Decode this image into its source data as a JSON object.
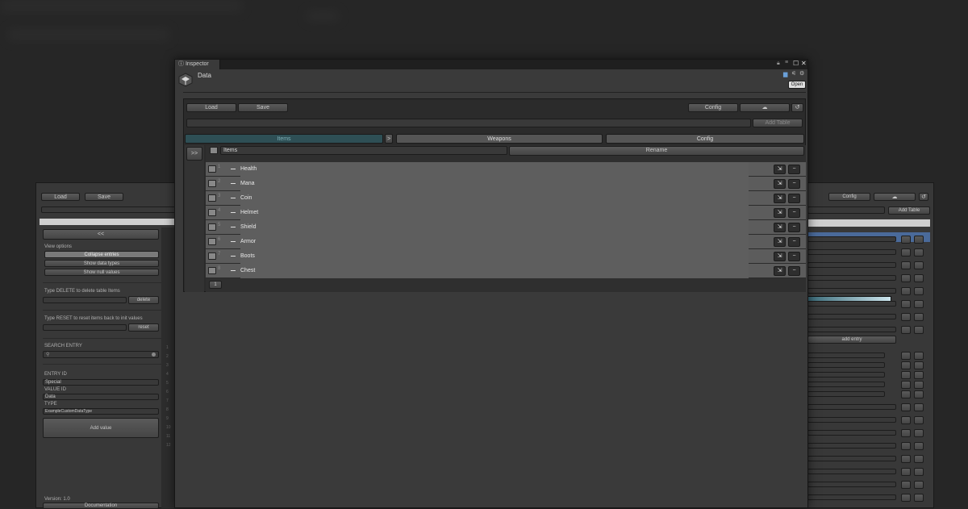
{
  "left_window": {
    "load": "Load",
    "save": "Save",
    "collapse_arrows": "<<",
    "view_options": "View options",
    "collapse_entries": "Collapse entries",
    "show_data_types": "Show data types",
    "show_null_values": "Show null values",
    "delete_hint": "Type DELETE to delete table Items",
    "delete_button": "delete",
    "reset_hint": "Type RESET to reset items back to init values",
    "reset_button": "reset",
    "search_entry": "SEARCH ENTRY",
    "entry_id_label": "ENTRY ID",
    "entry_id_value": "Special",
    "value_id_label": "VALUE ID",
    "value_id_value": "Data",
    "type_label": "TYPE",
    "type_value": "ExampleCustomDataType",
    "add_value": "Add value",
    "version": "Version: 1.0",
    "documentation": "Documentation",
    "line_numbers": [
      "1",
      "2",
      "3",
      "4",
      "5",
      "6",
      "7",
      "8",
      "9",
      "10",
      "11",
      "12"
    ]
  },
  "right_window": {
    "config": "Config",
    "add_table": "Add Table",
    "add_entry": "add entry"
  },
  "inspector": {
    "tab_label": "Inspector",
    "object_name": "Data",
    "open_button": "Open",
    "load_button": "Load",
    "save_button": "Save",
    "config_button": "Config",
    "add_table_button": "Add Table",
    "tabs": [
      "Items",
      "Weapons",
      "Config"
    ],
    "tab_arrow": ">",
    "expand_button": ">>",
    "table_name": "Items",
    "rename_button": "Rename",
    "page_number": "1",
    "rows": [
      {
        "num": "1",
        "name": "Health"
      },
      {
        "num": "2",
        "name": "Mana"
      },
      {
        "num": "3",
        "name": "Coin"
      },
      {
        "num": "4",
        "name": "Helmet"
      },
      {
        "num": "5",
        "name": "Shield"
      },
      {
        "num": "6",
        "name": "Armor"
      },
      {
        "num": "7",
        "name": "Boots"
      },
      {
        "num": "8",
        "name": "Chest"
      }
    ]
  },
  "colors": {
    "accent_tab": "#2e4f55",
    "selection_blue": "#4a6a9a"
  }
}
